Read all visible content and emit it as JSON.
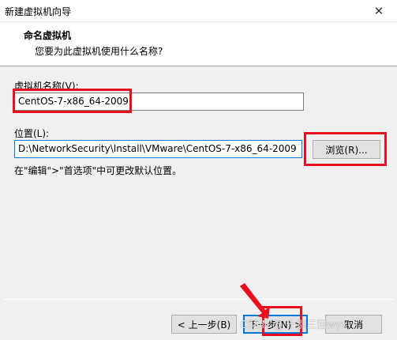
{
  "window": {
    "title": "新建虚拟机向导",
    "close_glyph": "✕"
  },
  "header": {
    "title": "命名虚拟机",
    "subtitle": "您要为此虚拟机使用什么名称?"
  },
  "vm_name": {
    "label": "虚拟机名称(V):",
    "value": "CentOS-7-x86_64-2009"
  },
  "location": {
    "label": "位置(L):",
    "value": "D:\\NetworkSecurity\\Install\\VMware\\CentOS-7-x86_64-2009",
    "browse_label": "浏览(R)..."
  },
  "hint": "在\"编辑\">\"首选项\"中可更改默认位置。",
  "footer": {
    "back_label": "< 上一步(B)",
    "next_label": "下一步(N) >",
    "cancel_label": "取消"
  },
  "watermark": "CSDN @ 十别三回wyx",
  "colors": {
    "highlight": "#e8101f",
    "accent": "#0078d7"
  }
}
